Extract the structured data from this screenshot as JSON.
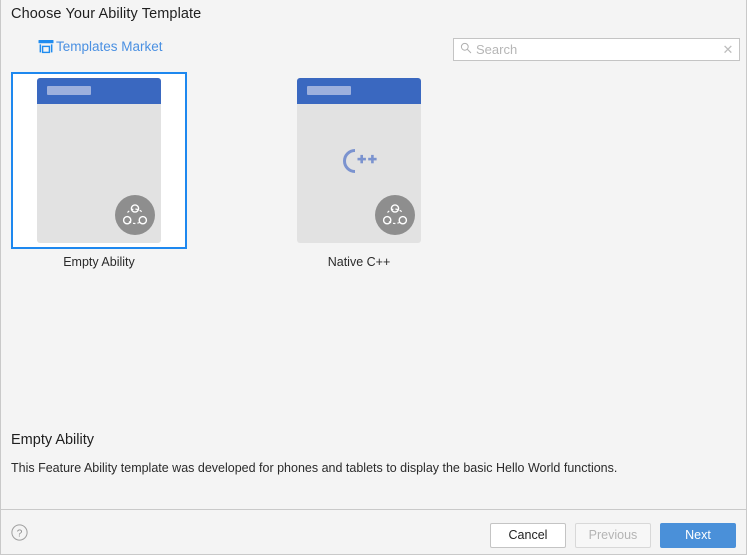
{
  "header": {
    "title": "Choose Your Ability Template",
    "market_link": {
      "label": "Templates Market",
      "icon": "store-icon"
    }
  },
  "search": {
    "placeholder": "Search",
    "value": "",
    "icon": "search-icon",
    "clear_label": "✕"
  },
  "templates": [
    {
      "id": "empty-ability",
      "label": "Empty Ability",
      "selected": true,
      "thumbnail": {
        "header_color": "#3a68c0",
        "body_color": "#e2e2e2",
        "badge_icon": "ability-badge-icon",
        "center_logo": null
      }
    },
    {
      "id": "native-cpp",
      "label": "Native C++",
      "selected": false,
      "thumbnail": {
        "header_color": "#3a68c0",
        "body_color": "#e2e2e2",
        "badge_icon": "ability-badge-icon",
        "center_logo": "cpp-logo-icon"
      }
    }
  ],
  "description": {
    "title": "Empty Ability",
    "text": "This Feature Ability template was developed for phones and tablets to display the basic Hello World functions."
  },
  "footer": {
    "help_icon": "help-circle-icon",
    "buttons": {
      "cancel": "Cancel",
      "previous": "Previous",
      "next": "Next"
    }
  },
  "colors": {
    "selection_blue": "#1e88ef",
    "link_blue": "#4a90e2",
    "primary_button": "#4a90d9",
    "card_header_blue": "#3a68c0",
    "background": "#f4f4f4"
  }
}
